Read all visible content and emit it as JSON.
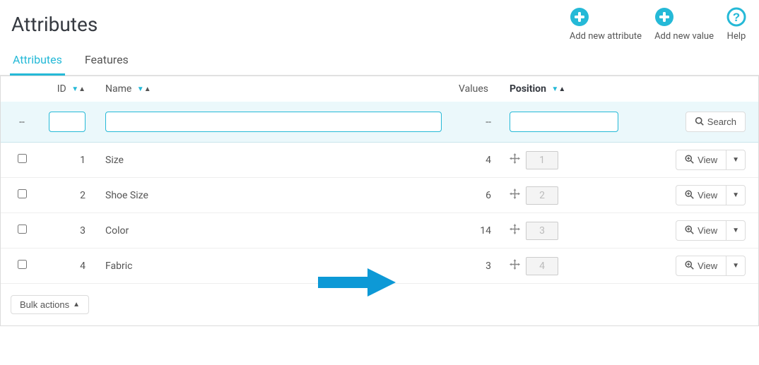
{
  "page": {
    "title": "Attributes"
  },
  "toolbar": {
    "add_attribute": "Add new attribute",
    "add_value": "Add new value",
    "help": "Help"
  },
  "tabs": {
    "attributes": "Attributes",
    "features": "Features"
  },
  "columns": {
    "id": "ID",
    "name": "Name",
    "values": "Values",
    "position": "Position"
  },
  "filter": {
    "dash": "--",
    "search": "Search"
  },
  "rows": [
    {
      "id": "1",
      "name": "Size",
      "values": "4",
      "position": "1"
    },
    {
      "id": "2",
      "name": "Shoe Size",
      "values": "6",
      "position": "2"
    },
    {
      "id": "3",
      "name": "Color",
      "values": "14",
      "position": "3"
    },
    {
      "id": "4",
      "name": "Fabric",
      "values": "3",
      "position": "4"
    }
  ],
  "actions": {
    "view": "View"
  },
  "bulk": {
    "label": "Bulk actions"
  }
}
